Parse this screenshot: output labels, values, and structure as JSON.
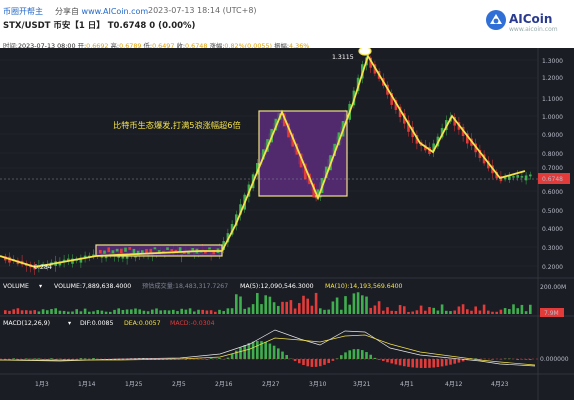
{
  "header": {
    "site_name": "币圈开帮主",
    "share_prefix": "分享自",
    "share_url": "www.AICoin.com",
    "timestamp": "2023-07-13 18:14 (UTC+8)",
    "title": "STX/USDT 币安【1 日】 T0.6748  0 (0.00%)",
    "logo_text": "AICoin",
    "logo_url": "www.aicoin.com"
  },
  "ohlc": {
    "time_label": "时间:",
    "time_value": "2023-07-13 08:00",
    "open_label": "开:",
    "open_value": "0.6692",
    "high_label": "高:",
    "high_value": "0.6789",
    "low_label": "低:",
    "low_value": "0.6497",
    "close_label": "收:",
    "close_value": "0.6748",
    "change_label": "涨幅:",
    "change_value": "0.82%(0.0055)",
    "amp_label": "振幅:",
    "amp_value": "4.36%"
  },
  "annotations": {
    "headline": "比特币生态爆发,打满5浪涨幅超6倍",
    "peak_label": "1.3115",
    "low_label": "0.284",
    "last_price": "0.6748"
  },
  "volume": {
    "title": "VOLUME",
    "value_label": "VOLUME:7,889,638.4000",
    "forecast_label": "预估成交量:18,483,317.7267",
    "ma5_label": "MA(5):12,090,546.3000",
    "ma10_label": "MA(10):14,193,569.6400",
    "axis_top": "200.00M",
    "last_badge": "7.9M"
  },
  "macd": {
    "title": "MACD(12,26,9)",
    "dif_label": "DIF:0.0085",
    "dea_label": "DEA:0.0057",
    "macd_label": "MACD:-0.0304",
    "axis_zero": "0.000000"
  },
  "x_axis": [
    "1月3",
    "1月14",
    "1月25",
    "2月5",
    "2月16",
    "2月27",
    "3月10",
    "3月21",
    "4月1",
    "4月12",
    "4月23"
  ],
  "y_axis": [
    "1.3000",
    "1.2000",
    "1.1000",
    "1.0000",
    "0.9000",
    "0.8000",
    "0.7000",
    "0.6000",
    "0.5000",
    "0.4000",
    "0.3000",
    "0.2000"
  ],
  "colors": {
    "up": "#3fae4f",
    "down": "#e33a3a",
    "wave_line": "#f4e34a",
    "box_fill": "#5a2b7a",
    "box_border": "#f0e08a",
    "background": "#1b1d24"
  }
}
